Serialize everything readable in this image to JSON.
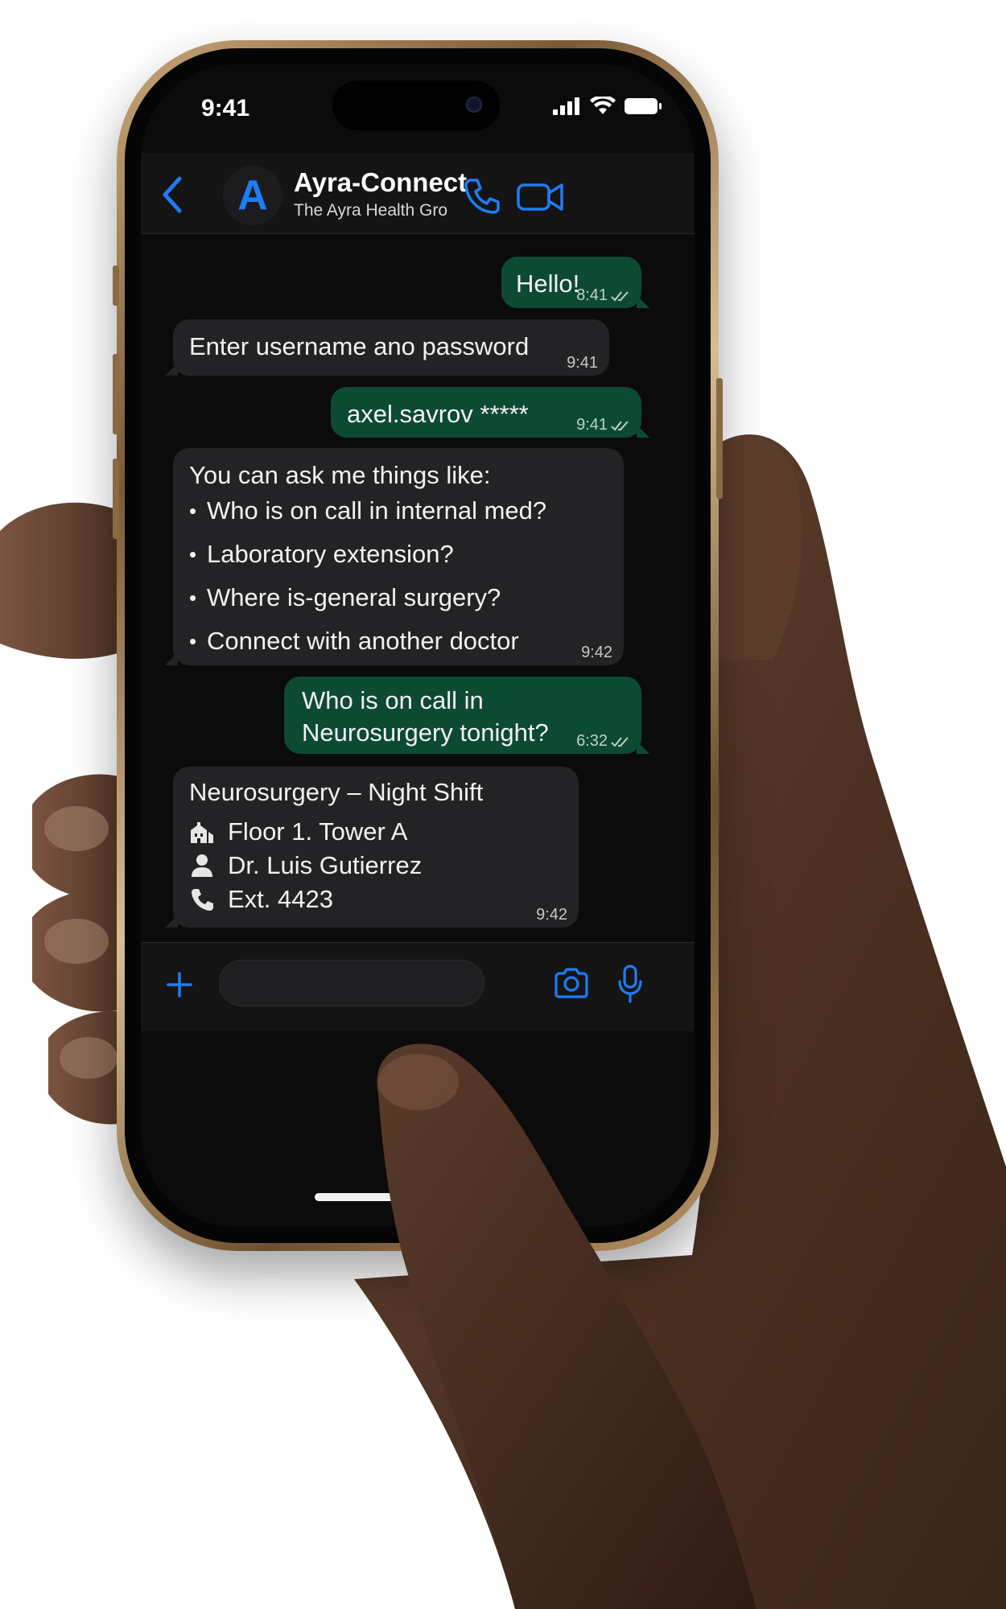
{
  "status_bar": {
    "time": "9:41",
    "icons": [
      "cellular-signal-icon",
      "wifi-icon",
      "battery-icon"
    ]
  },
  "header": {
    "back_icon": "chevron-left-icon",
    "avatar_letter": "A",
    "title": "Ayra-Connect",
    "subtitle": "The Ayra Health Gro",
    "actions": [
      "phone-call-icon",
      "video-call-icon"
    ]
  },
  "messages": [
    {
      "direction": "out",
      "text": "Hello!",
      "time": "8:41",
      "status_icon": "double-check-icon"
    },
    {
      "direction": "in",
      "text": "Enter username ano password",
      "time": "9:41"
    },
    {
      "direction": "out",
      "text": "axel.savrov *****",
      "time": "9:41",
      "status_icon": "double-check-icon"
    },
    {
      "direction": "in",
      "text": "You can ask me things like:",
      "bullets": [
        "Who is on call in internal med?",
        "Laboratory extension?",
        "Where is-general surgery?",
        "Connect with another doctor"
      ],
      "time": "9:42"
    },
    {
      "direction": "out",
      "text_lines": [
        "Who is on call in",
        "Neurosurgery tonight?"
      ],
      "time": "6:32",
      "status_icon": "double-check-icon"
    },
    {
      "direction": "in",
      "title": "Neurosurgery – Night Shift",
      "details": [
        {
          "icon": "building-icon",
          "text": "Floor 1. Tower A"
        },
        {
          "icon": "person-icon",
          "text": "Dr. Luis Gutierrez"
        },
        {
          "icon": "phone-icon",
          "text": "Ext. 4423"
        }
      ],
      "time": "9:42"
    }
  ],
  "input_bar": {
    "left_icon": "plus-icon",
    "placeholder": "",
    "right_icons": [
      "camera-icon",
      "microphone-icon"
    ]
  },
  "colors": {
    "accent": "#1f7cf4",
    "outgoing_bubble": "#0d4a33",
    "incoming_bubble": "#232325",
    "background": "#0b0b0b"
  }
}
